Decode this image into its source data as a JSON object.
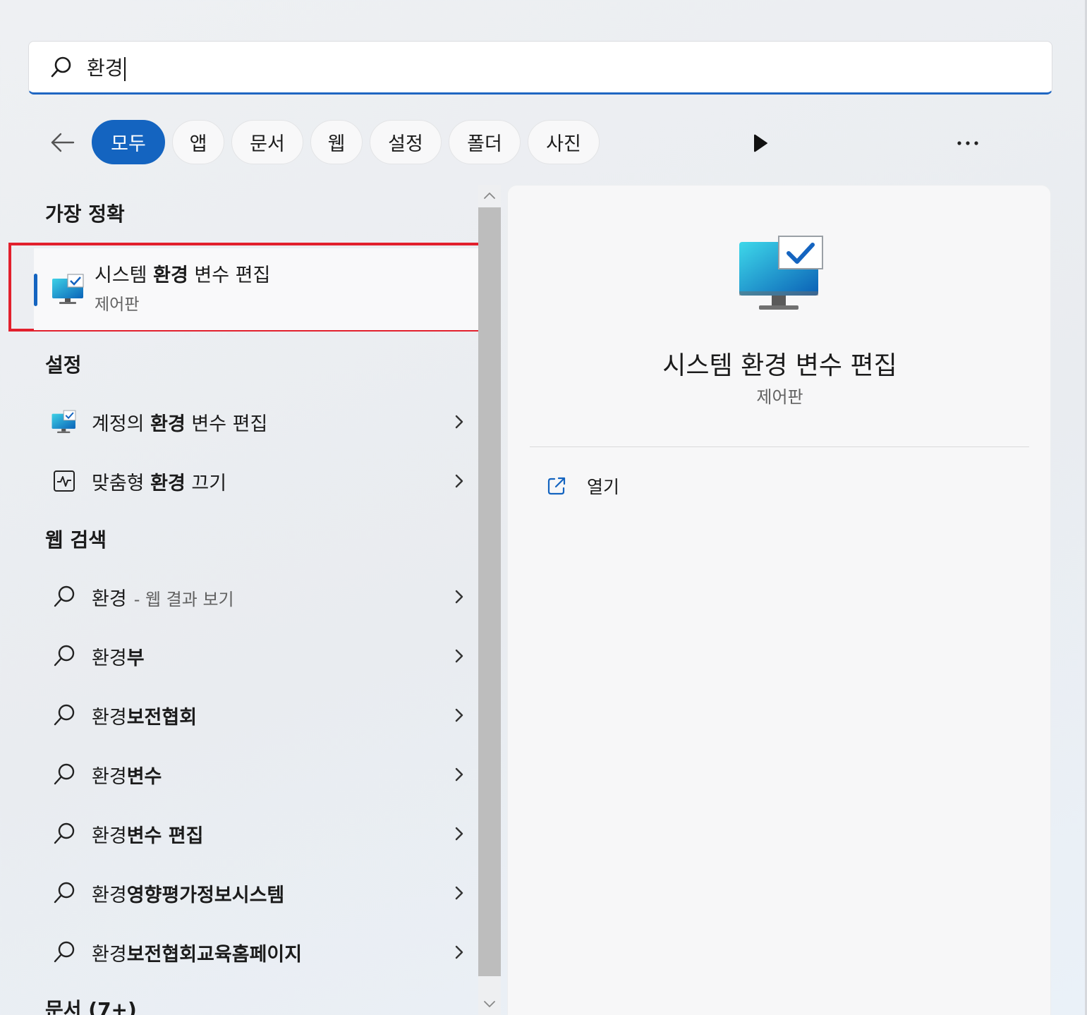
{
  "search": {
    "query": "환경"
  },
  "filters": {
    "back_icon": "arrow-left-icon",
    "chips": [
      {
        "label": "모두",
        "active": true
      },
      {
        "label": "앱",
        "active": false
      },
      {
        "label": "문서",
        "active": false
      },
      {
        "label": "웹",
        "active": false
      },
      {
        "label": "설정",
        "active": false
      },
      {
        "label": "폴더",
        "active": false
      },
      {
        "label": "사진",
        "active": false
      }
    ],
    "play_icon": "play-icon",
    "more_icon": "more-icon"
  },
  "results": {
    "best_match": {
      "section_title": "가장 정확",
      "title_pre": "시스템 ",
      "title_bold": "환경",
      "title_post": " 변수 편집",
      "subtitle": "제어판"
    },
    "settings": {
      "section_title": "설정",
      "items": [
        {
          "pre": "계정의 ",
          "bold": "환경",
          "post": " 변수 편집"
        },
        {
          "pre": "맞춤형 ",
          "bold": "환경",
          "post": " 끄기"
        }
      ]
    },
    "web": {
      "section_title": "웹 검색",
      "items": [
        {
          "pre": "환경",
          "bold": "",
          "post": "",
          "hint": "- 웹 결과 보기"
        },
        {
          "pre": "환경",
          "bold": "부",
          "post": "",
          "hint": ""
        },
        {
          "pre": "환경",
          "bold": "보전협회",
          "post": "",
          "hint": ""
        },
        {
          "pre": "환경",
          "bold": "변수",
          "post": "",
          "hint": ""
        },
        {
          "pre": "환경",
          "bold": "변수 편집",
          "post": "",
          "hint": ""
        },
        {
          "pre": "환경",
          "bold": "영향평가정보시스템",
          "post": "",
          "hint": ""
        },
        {
          "pre": "환경",
          "bold": "보전협회교육홈페이지",
          "post": "",
          "hint": ""
        }
      ]
    },
    "documents": {
      "section_title": "문서 (7+)"
    }
  },
  "preview": {
    "title": "시스템 환경 변수 편집",
    "subtitle": "제어판",
    "actions": [
      {
        "label": "열기",
        "icon": "open-external-icon"
      }
    ]
  },
  "colors": {
    "accent": "#1464c0",
    "highlight_border": "#e2202d"
  }
}
